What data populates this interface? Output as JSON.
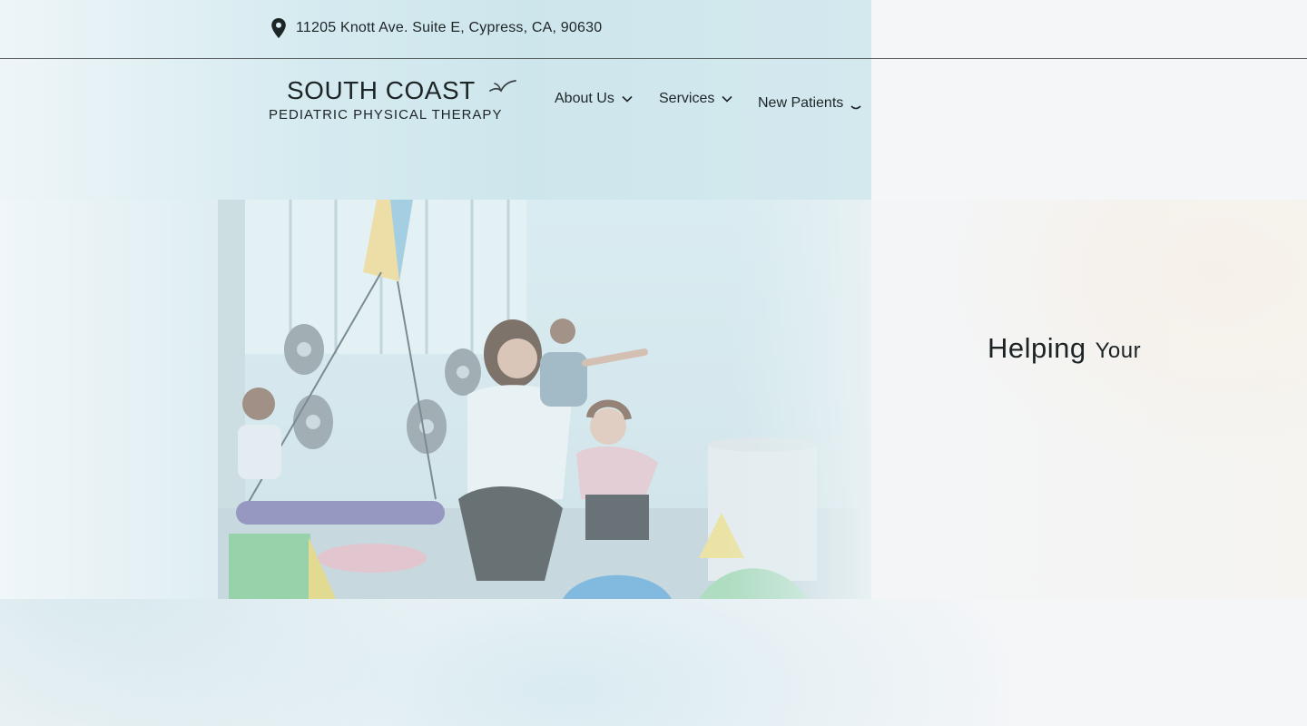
{
  "topbar": {
    "address": "11205 Knott Ave. Suite E, Cypress, CA, 90630",
    "address_icon": "map-pin-icon"
  },
  "logo": {
    "main": "SOUTH COAST",
    "sub": "PEDIATRIC PHYSICAL THERAPY",
    "icon": "bird-icon"
  },
  "nav": {
    "items": [
      {
        "label": "About Us",
        "icon": "chevron-down-icon"
      },
      {
        "label": "Services",
        "icon": "chevron-down-icon"
      },
      {
        "label": "New Patients",
        "icon": "chevron-down-icon"
      }
    ]
  },
  "hero": {
    "heading_word1": "Helping",
    "heading_word2": "Your"
  },
  "colors": {
    "tint": "#cde6ec",
    "text": "#1e2527",
    "background": "#f5f6f8"
  }
}
